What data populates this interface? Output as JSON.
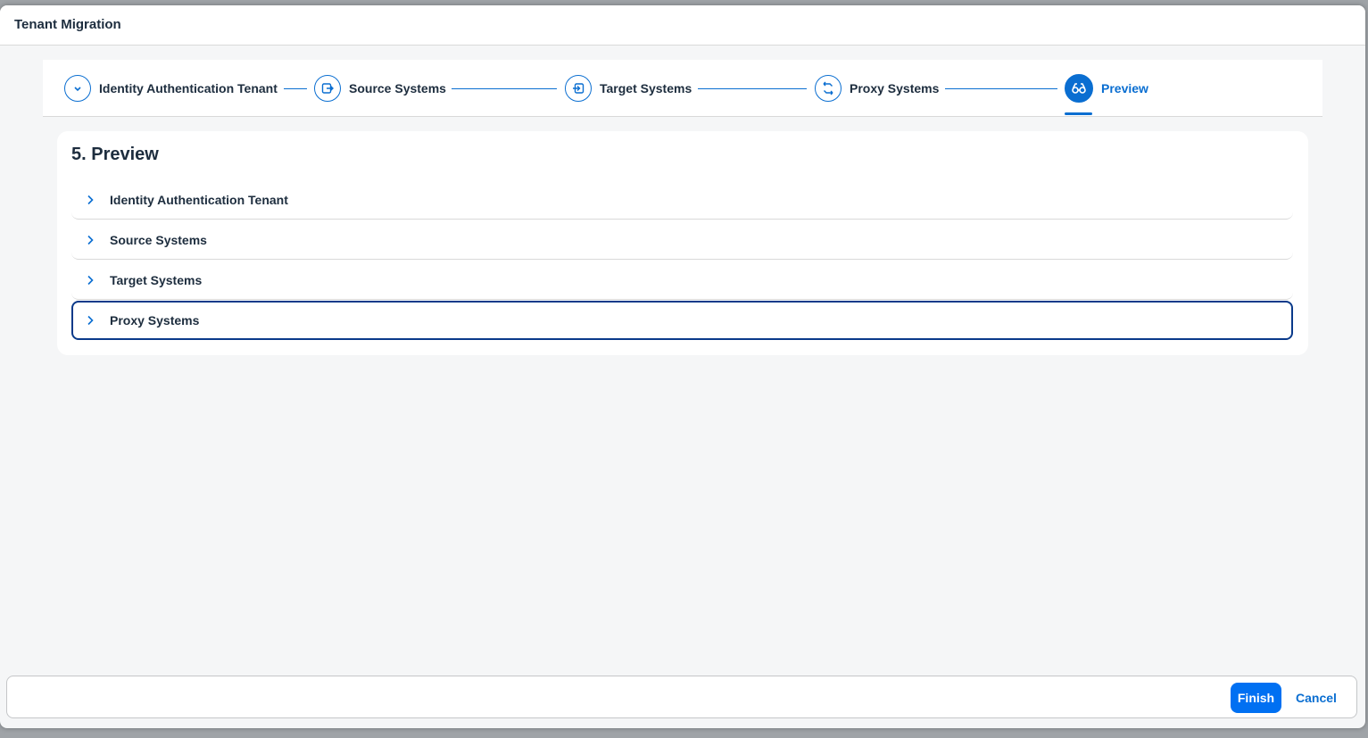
{
  "dialog": {
    "title": "Tenant Migration"
  },
  "wizard": {
    "steps": [
      {
        "label": "Identity Authentication Tenant",
        "icon": "chevron-down-icon"
      },
      {
        "label": "Source Systems",
        "icon": "export-icon"
      },
      {
        "label": "Target Systems",
        "icon": "import-icon"
      },
      {
        "label": "Proxy Systems",
        "icon": "swap-arrows-icon"
      },
      {
        "label": "Preview",
        "icon": "glasses-icon",
        "active": true
      }
    ]
  },
  "preview": {
    "title": "5. Preview",
    "panels": [
      {
        "label": "Identity Authentication Tenant"
      },
      {
        "label": "Source Systems"
      },
      {
        "label": "Target Systems"
      },
      {
        "label": "Proxy Systems",
        "focused": true
      }
    ]
  },
  "footer": {
    "finish_label": "Finish",
    "cancel_label": "Cancel"
  },
  "colors": {
    "accent": "#0a6ed1",
    "primary_button": "#0070f2",
    "focus_border": "#0a3a8a"
  }
}
